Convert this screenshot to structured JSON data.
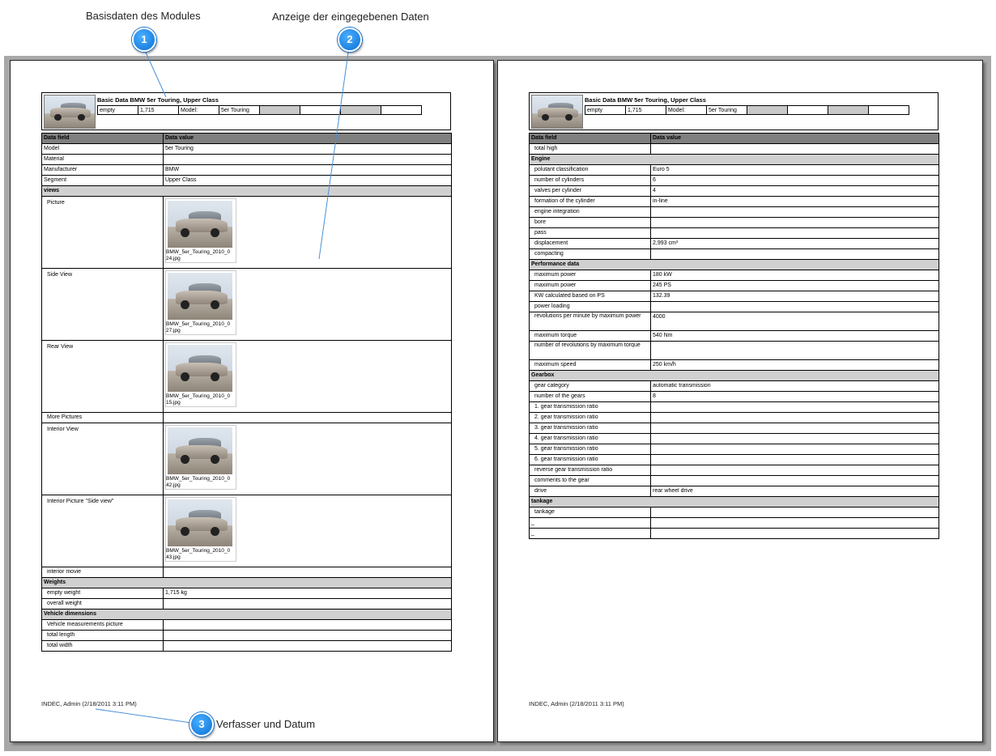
{
  "callouts": [
    {
      "number": "1",
      "label": "Basisdaten des Modules"
    },
    {
      "number": "2",
      "label": "Anzeige der eingegebenen Daten"
    },
    {
      "number": "3",
      "label": "Verfasser und Datum"
    }
  ],
  "header": {
    "title": "Basic Data BMW 5er Touring, Upper Class",
    "cells": [
      "empty",
      "1,715",
      "Model:",
      "5er Touring",
      "",
      "",
      "",
      ""
    ]
  },
  "table_headers": [
    "Data field",
    "Data value"
  ],
  "page1": {
    "rows": [
      {
        "type": "row",
        "field": "Model",
        "value": "5er Touring"
      },
      {
        "type": "row",
        "field": "Material",
        "value": ""
      },
      {
        "type": "row",
        "field": "Manufacturer",
        "value": "BMW"
      },
      {
        "type": "row",
        "field": "Segment",
        "value": "Upper Class"
      },
      {
        "type": "section",
        "field": "views"
      },
      {
        "type": "image",
        "field": "Picture",
        "file": "BMW_5er_Touring_2010_024.jpg",
        "file_line1": "BMW_5er_Touring_2010_0",
        "file_line2": "24.jpg"
      },
      {
        "type": "image",
        "field": "Side View",
        "file": "BMW_5er_Touring_2010_027.jpg",
        "file_line1": "BMW_5er_Touring_2010_0",
        "file_line2": "27.jpg"
      },
      {
        "type": "image",
        "field": "Rear View",
        "file": "BMW_5er_Touring_2010_015.jpg",
        "file_line1": "BMW_5er_Touring_2010_0",
        "file_line2": "15.jpg"
      },
      {
        "type": "row",
        "field": "More Pictures",
        "value": ""
      },
      {
        "type": "image",
        "field": "Interior View",
        "file": "BMW_5er_Touring_2010_042.jpg",
        "file_line1": "BMW_5er_Touring_2010_0",
        "file_line2": "42.jpg"
      },
      {
        "type": "image",
        "field": "Interior Picture \"Side view\"",
        "file": "BMW_5er_Touring_2010_043.jpg",
        "file_line1": "BMW_5er_Touring_2010_0",
        "file_line2": "43.jpg"
      },
      {
        "type": "row",
        "field": "interior movie",
        "value": ""
      },
      {
        "type": "section",
        "field": "Weights"
      },
      {
        "type": "row",
        "field": "empty weight",
        "value": "1,715 kg"
      },
      {
        "type": "row",
        "field": "overall weight",
        "value": ""
      },
      {
        "type": "section",
        "field": "Vehicle dimensions"
      },
      {
        "type": "row",
        "field": "Vehicle measurements picture",
        "value": ""
      },
      {
        "type": "row",
        "field": "total length",
        "value": ""
      },
      {
        "type": "row",
        "field": "total width",
        "value": ""
      }
    ],
    "footer": "INDEC, Admin (2/18/2011 3:11 PM)"
  },
  "page2": {
    "rows": [
      {
        "type": "row",
        "field": "total high",
        "value": ""
      },
      {
        "type": "section",
        "field": "Engine"
      },
      {
        "type": "row",
        "field": "polutant classification",
        "value": "Euro 5"
      },
      {
        "type": "row",
        "field": "number of cylinders",
        "value": "6"
      },
      {
        "type": "row",
        "field": "valves per cylinder",
        "value": "4"
      },
      {
        "type": "row",
        "field": "formation of the cylinder",
        "value": "in-line"
      },
      {
        "type": "row",
        "field": "engine integration",
        "value": ""
      },
      {
        "type": "row",
        "field": "bore",
        "value": ""
      },
      {
        "type": "row",
        "field": "pass",
        "value": ""
      },
      {
        "type": "row",
        "field": "displacement",
        "value": "2,993 cm³"
      },
      {
        "type": "row",
        "field": "compacting",
        "value": ""
      },
      {
        "type": "section",
        "field": "Performance data"
      },
      {
        "type": "row",
        "field": "maximum power",
        "value": "180 kW"
      },
      {
        "type": "row",
        "field": "maximum power",
        "value": "245 PS"
      },
      {
        "type": "row",
        "field": "KW calculated based on PS",
        "value": "132.39"
      },
      {
        "type": "row",
        "field": "power loading",
        "value": ""
      },
      {
        "type": "row2",
        "field": "revolutions per minute by maximum power",
        "value": "4000"
      },
      {
        "type": "row",
        "field": "maximum torque",
        "value": "540 Nm"
      },
      {
        "type": "row2",
        "field": "number of revolutions by maximum torque",
        "value": ""
      },
      {
        "type": "row",
        "field": "maximum speed",
        "value": "250 km/h"
      },
      {
        "type": "section",
        "field": "Gearbox"
      },
      {
        "type": "row",
        "field": "gear category",
        "value": "automatic transmission"
      },
      {
        "type": "row",
        "field": "number of the gears",
        "value": "8"
      },
      {
        "type": "row",
        "field": "1. gear transmission ratio",
        "value": ""
      },
      {
        "type": "row",
        "field": "2. gear transmission ratio",
        "value": ""
      },
      {
        "type": "row",
        "field": "3. gear transmission ratio",
        "value": ""
      },
      {
        "type": "row",
        "field": "4. gear transmission ratio",
        "value": ""
      },
      {
        "type": "row",
        "field": "5. gear transmission ratio",
        "value": ""
      },
      {
        "type": "row",
        "field": "6. gear transmission ratio",
        "value": ""
      },
      {
        "type": "row",
        "field": "reverse  gear transmission ratio",
        "value": ""
      },
      {
        "type": "row",
        "field": "comments to the gear",
        "value": ""
      },
      {
        "type": "row",
        "field": "drive",
        "value": "rear wheel drive"
      },
      {
        "type": "section",
        "field": "tankage"
      },
      {
        "type": "row",
        "field": "tankage",
        "value": ""
      },
      {
        "type": "plain",
        "field": "_",
        "value": ""
      },
      {
        "type": "plain",
        "field": "_",
        "value": ""
      }
    ],
    "footer": "INDEC, Admin (2/18/2011 3:11 PM)"
  },
  "colors": {
    "workspace": "#a8a8a8",
    "table_head": "#808080",
    "section": "#d0d0d0",
    "badge": "#1a84ea"
  }
}
